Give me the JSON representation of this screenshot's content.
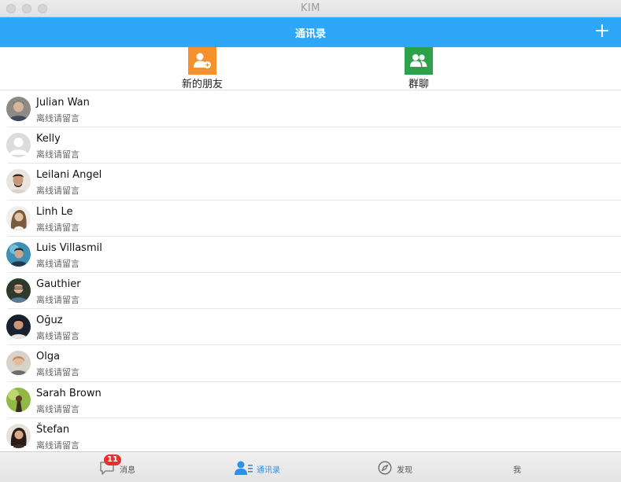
{
  "window": {
    "title": "KIM"
  },
  "header": {
    "title": "通讯录",
    "add_icon": "plus-icon"
  },
  "quick_entries": [
    {
      "label": "新的朋友",
      "icon": "add-friend-icon",
      "color": "#f5902d"
    },
    {
      "label": "群聊",
      "icon": "group-icon",
      "color": "#2da14a"
    }
  ],
  "contacts": [
    {
      "name": "Julian Wan",
      "status": "离线请留言"
    },
    {
      "name": "Kelly",
      "status": "离线请留言"
    },
    {
      "name": "Leilani Angel",
      "status": "离线请留言"
    },
    {
      "name": "Linh Le",
      "status": "离线请留言"
    },
    {
      "name": "Luis Villasmil",
      "status": "离线请留言"
    },
    {
      "name": "Gauthier",
      "status": "离线请留言"
    },
    {
      "name": "Oğuz",
      "status": "离线请留言"
    },
    {
      "name": "Olga",
      "status": "离线请留言"
    },
    {
      "name": "Sarah Brown",
      "status": "离线请留言"
    },
    {
      "name": "Štefan",
      "status": "离线请留言"
    }
  ],
  "tabbar": {
    "messages": {
      "label": "消息",
      "badge": "11",
      "icon": "chat-bubble-icon"
    },
    "contacts": {
      "label": "通讯录",
      "icon": "contacts-icon",
      "active": true
    },
    "discover": {
      "label": "发现",
      "icon": "compass-icon"
    },
    "me": {
      "label": "我"
    }
  },
  "colors": {
    "accent": "#2ea7f8",
    "badge": "#e8302f",
    "active_tab": "#2e8fe6"
  }
}
